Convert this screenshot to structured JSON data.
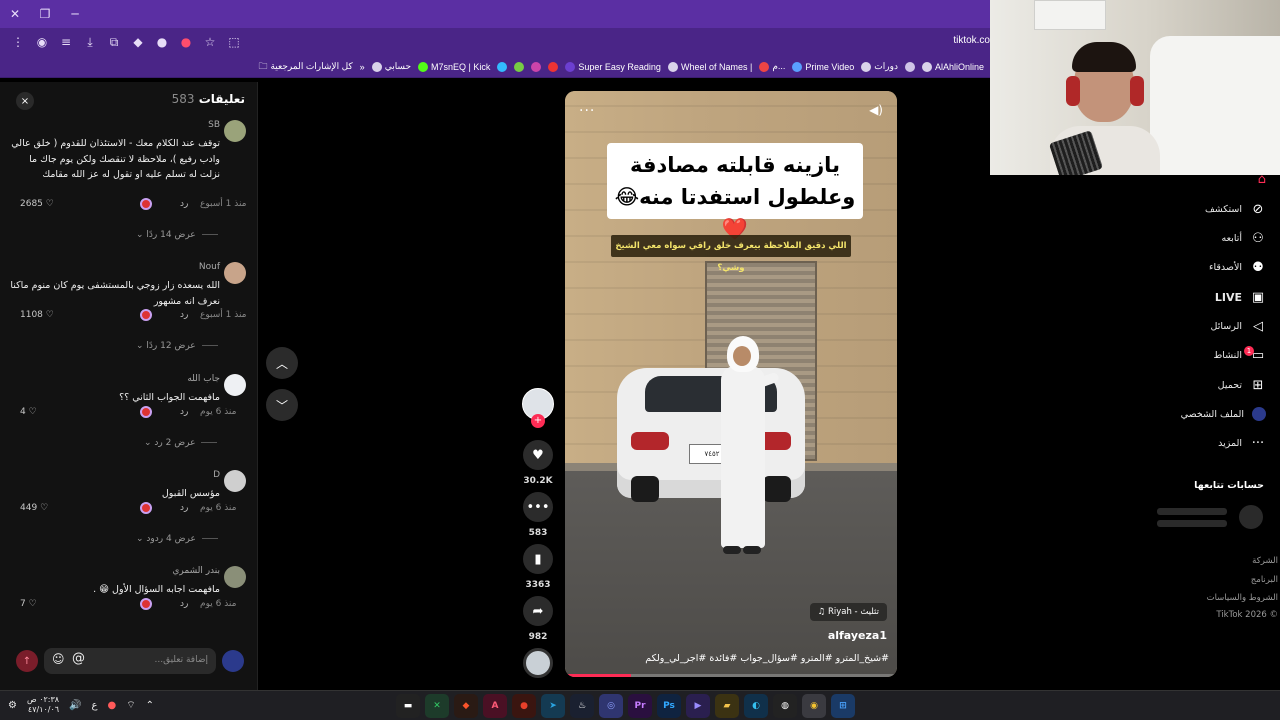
{
  "browser": {
    "url": "tiktok.co",
    "bookmarks": [
      {
        "label": "AlAhliOnline"
      },
      {
        "label": ""
      },
      {
        "label": "دورات"
      },
      {
        "label": "Prime Video"
      },
      {
        "label": "م..."
      },
      {
        "label": "Wheel of Names |"
      },
      {
        "label": "Super Easy Reading"
      },
      {
        "label": ""
      },
      {
        "label": ""
      },
      {
        "label": ""
      },
      {
        "label": ""
      },
      {
        "label": "M7snEQ | Kick"
      },
      {
        "label": "حسابي"
      }
    ],
    "bookmarks_folder": "كل الإشارات المرجعية"
  },
  "comments": {
    "title": "تعليقات",
    "count": "583",
    "close_icon": "×",
    "items": [
      {
        "user": "SB",
        "text": "توقف عند الكلام معك - الاستئذان للقدوم ( خلق عالي وادب رفيع )، ملاحظة لا تنقصك ولكن يوم جاك ما نزلت له تسلم عليه او تقول له عز الله مقامك",
        "likes": "2685",
        "reply": "رد",
        "time": "منذ 1 أسبوع",
        "more": "عرض 14 ردًا"
      },
      {
        "user": "Nouf",
        "text": "الله يسعده زار زوجي بالمستشفى يوم كان منوم ماكنا نعرف انه مشهور",
        "likes": "1108",
        "reply": "رد",
        "time": "منذ 1 أسبوع",
        "more": "عرض 12 ردًا"
      },
      {
        "user": "جاب الله",
        "text": "مافهمت الجواب الثاني ؟؟",
        "likes": "4",
        "reply": "رد",
        "time": "منذ 6 يوم",
        "more": "عرض 2 رد"
      },
      {
        "user": "D",
        "text": "مؤسس القبول",
        "likes": "449",
        "reply": "رد",
        "time": "منذ 6 يوم",
        "more": "عرض 4 ردود"
      },
      {
        "user": "بندر الشمري",
        "text": "مافهمت اجابه السؤال الأول 😁 .",
        "likes": "7",
        "reply": "رد",
        "time": "منذ 6 يوم",
        "more": ""
      }
    ],
    "input_placeholder": "إضافة تعليق...",
    "at_symbol": "@"
  },
  "video": {
    "title_line1": "يازينه قابلته مصادفة",
    "title_line2": "وعلطول استفدتا منه😂❤️",
    "subtitle": "اللي دقيق الملاحظة بيعرف خلق راقي سواه معي الشيخ وشي؟",
    "plate": "٧٤٥٢",
    "music": "تثليث - Riyah",
    "author": "alfayeza1",
    "caption": "#شيخ_المترو #المترو #سؤال_جواب #فائدة #اجر_لي_ولكم",
    "progress": 0.2
  },
  "actions": {
    "likes": "30.2K",
    "comments": "583",
    "saves": "3363",
    "shares": "982"
  },
  "nav": {
    "items": [
      {
        "label": "استكشف",
        "icon": "compass-icon"
      },
      {
        "label": "أتابعه",
        "icon": "user-follow-icon"
      },
      {
        "label": "الأصدقاء",
        "icon": "friends-icon"
      },
      {
        "label": "LIVE",
        "icon": "live-icon"
      },
      {
        "label": "الرسائل",
        "icon": "send-icon"
      },
      {
        "label": "النشاط",
        "icon": "inbox-icon"
      },
      {
        "label": "تحميل",
        "icon": "upload-icon"
      },
      {
        "label": "الملف الشخصي",
        "icon": "avatar-icon"
      },
      {
        "label": "المزيد",
        "icon": "more-icon"
      }
    ],
    "activity_badge": "1",
    "following_title": "حسابات تتابعها",
    "footer": [
      "الشركة",
      "البرنامج",
      "الشروط والسياسات",
      "© TikTok 2026"
    ]
  },
  "taskbar": {
    "time": "٠٢:٣٨ ص",
    "date": "٤٧/١٠/٠٦",
    "lang": "ع"
  }
}
